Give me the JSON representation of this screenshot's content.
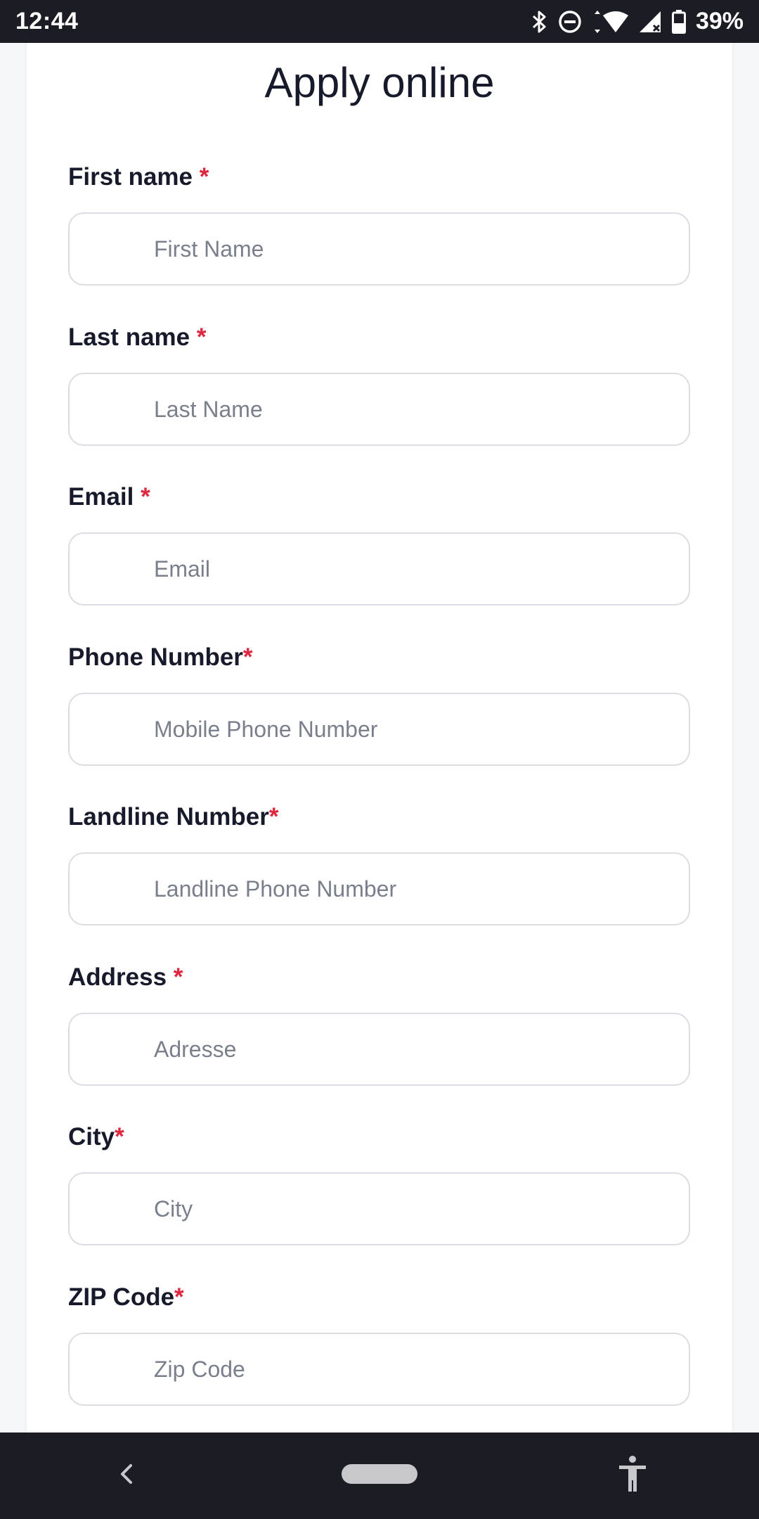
{
  "status_bar": {
    "time": "12:44",
    "battery": "39%",
    "icons": [
      "bluetooth-icon",
      "do-not-disturb-icon",
      "wifi-icon",
      "cellular-signal-icon",
      "battery-icon"
    ]
  },
  "form": {
    "title": "Apply online",
    "required_marker": "*",
    "fields": [
      {
        "label": "First name ",
        "placeholder": "First Name",
        "value": ""
      },
      {
        "label": "Last name ",
        "placeholder": "Last Name",
        "value": ""
      },
      {
        "label": "Email ",
        "placeholder": "Email",
        "value": ""
      },
      {
        "label": "Phone Number",
        "placeholder": "Mobile Phone Number",
        "value": ""
      },
      {
        "label": "Landline Number",
        "placeholder": "Landline Phone Number",
        "value": ""
      },
      {
        "label": "Address ",
        "placeholder": "Adresse",
        "value": ""
      },
      {
        "label": "City",
        "placeholder": "City",
        "value": ""
      },
      {
        "label": "ZIP Code",
        "placeholder": "Zip Code",
        "value": ""
      }
    ]
  },
  "nav_bar": {
    "icons": [
      "back-icon",
      "home-pill-icon",
      "accessibility-icon"
    ]
  },
  "colors": {
    "required": "#e0253f",
    "text": "#161a2b",
    "placeholder": "#7a7f8c",
    "input_border": "#dcdde2",
    "system_bar": "#1c1c24"
  }
}
